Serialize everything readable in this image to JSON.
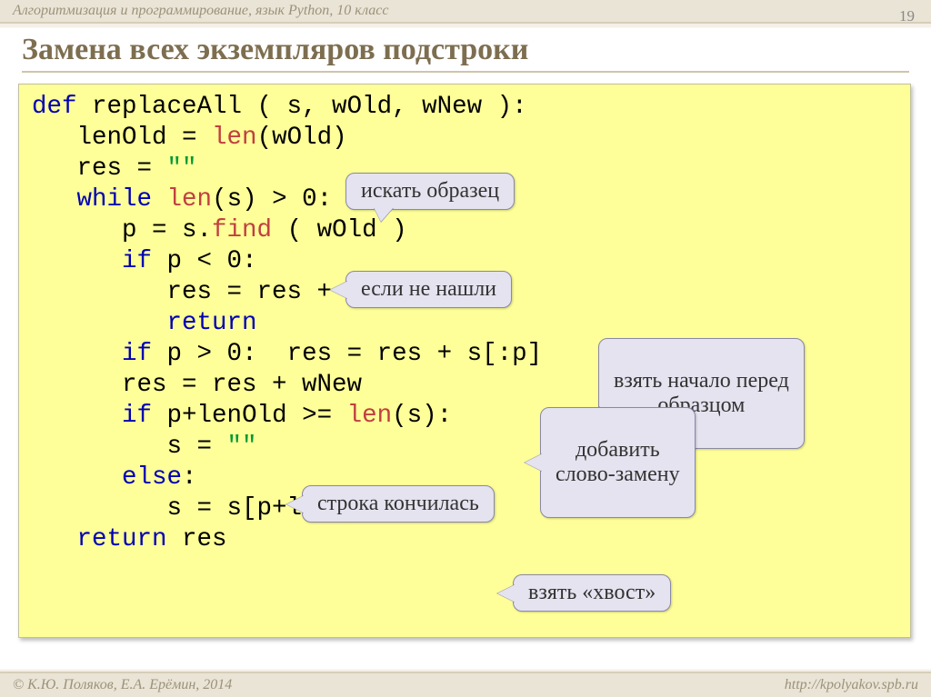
{
  "header": {
    "course": "Алгоритмизация и программирование, язык Python, 10 класс",
    "page": "19"
  },
  "title": "Замена всех экземпляров подстроки",
  "code": {
    "lines": [
      [
        {
          "t": "def",
          "c": "kw"
        },
        {
          "t": " replaceAll ( s, wOld, wNew ):"
        }
      ],
      [
        {
          "t": "   lenOld = "
        },
        {
          "t": "len",
          "c": "fn"
        },
        {
          "t": "(wOld)"
        }
      ],
      [
        {
          "t": "   res = "
        },
        {
          "t": "\"\"",
          "c": "gn"
        }
      ],
      [
        {
          "t": "   "
        },
        {
          "t": "while",
          "c": "kw"
        },
        {
          "t": " "
        },
        {
          "t": "len",
          "c": "fn"
        },
        {
          "t": "(s) > 0:"
        }
      ],
      [
        {
          "t": "      p = s."
        },
        {
          "t": "find",
          "c": "fn"
        },
        {
          "t": " ( wOld )"
        }
      ],
      [
        {
          "t": "      "
        },
        {
          "t": "if",
          "c": "kw"
        },
        {
          "t": " p < 0:"
        }
      ],
      [
        {
          "t": "         res = res + s"
        }
      ],
      [
        {
          "t": "         "
        },
        {
          "t": "return",
          "c": "kw"
        }
      ],
      [
        {
          "t": "      "
        },
        {
          "t": "if",
          "c": "kw"
        },
        {
          "t": " p > 0:  res = res + s[:p]"
        }
      ],
      [
        {
          "t": "      res = res + wNew"
        }
      ],
      [
        {
          "t": "      "
        },
        {
          "t": "if",
          "c": "kw"
        },
        {
          "t": " p+lenOld >= "
        },
        {
          "t": "len",
          "c": "fn"
        },
        {
          "t": "(s):"
        }
      ],
      [
        {
          "t": "         s = "
        },
        {
          "t": "\"\"",
          "c": "gn"
        }
      ],
      [
        {
          "t": "      "
        },
        {
          "t": "else",
          "c": "kw"
        },
        {
          "t": ":"
        }
      ],
      [
        {
          "t": "         s = s[p+lenOld:]"
        }
      ],
      [
        {
          "t": "   "
        },
        {
          "t": "return",
          "c": "kw"
        },
        {
          "t": " res"
        }
      ]
    ]
  },
  "callouts": {
    "c1": "искать образец",
    "c2": "если не нашли",
    "c3": "взять начало перед\nобразцом",
    "c4": "добавить\nслово-замену",
    "c5": "строка кончилась",
    "c6": "взять «хвост»"
  },
  "footer": {
    "left": "© К.Ю. Поляков, Е.А. Ерёмин, 2014",
    "right": "http://kpolyakov.spb.ru"
  }
}
